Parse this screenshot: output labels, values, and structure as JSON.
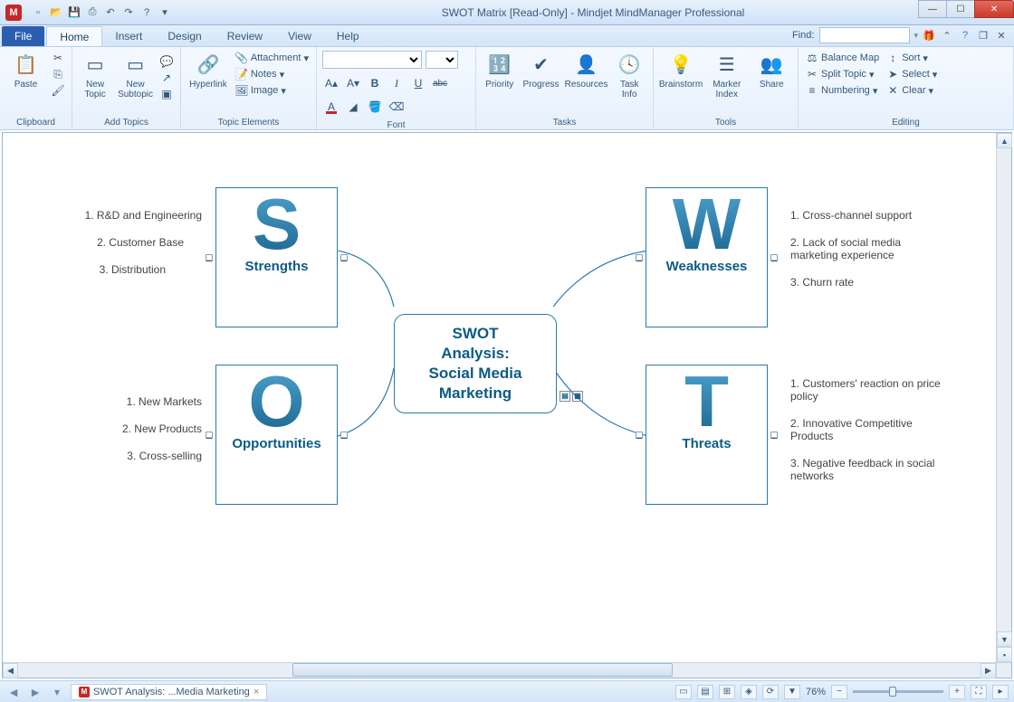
{
  "window": {
    "title": "SWOT Matrix [Read-Only] - Mindjet MindManager Professional",
    "appIconLetter": "M"
  },
  "tabs": {
    "file": "File",
    "home": "Home",
    "insert": "Insert",
    "design": "Design",
    "review": "Review",
    "view": "View",
    "help": "Help"
  },
  "find": {
    "label": "Find:",
    "value": ""
  },
  "ribbon": {
    "clipboard": {
      "paste": "Paste",
      "group": "Clipboard"
    },
    "addTopics": {
      "newTopic": "New\nTopic",
      "newSubtopic": "New\nSubtopic",
      "group": "Add Topics"
    },
    "topicElements": {
      "hyperlink": "Hyperlink",
      "attachment": "Attachment",
      "notes": "Notes",
      "image": "Image",
      "group": "Topic Elements"
    },
    "font": {
      "group": "Font",
      "increase": "A▴",
      "decrease": "A▾",
      "bold": "B",
      "italic": "I",
      "underline": "U",
      "strike": "abc"
    },
    "tasks": {
      "priority": "Priority",
      "progress": "Progress",
      "resources": "Resources",
      "taskInfo": "Task\nInfo",
      "group": "Tasks"
    },
    "tools": {
      "brainstorm": "Brainstorm",
      "markerIndex": "Marker\nIndex",
      "share": "Share",
      "group": "Tools"
    },
    "editing": {
      "balanceMap": "Balance Map",
      "splitTopic": "Split Topic",
      "numbering": "Numbering",
      "sort": "Sort",
      "select": "Select",
      "clear": "Clear",
      "group": "Editing"
    }
  },
  "mindmap": {
    "central": {
      "line1": "SWOT",
      "line2": "Analysis:",
      "line3": "Social Media",
      "line4": "Marketing"
    },
    "boxes": {
      "s": {
        "letter": "S",
        "label": "Strengths"
      },
      "w": {
        "letter": "W",
        "label": "Weaknesses"
      },
      "o": {
        "letter": "O",
        "label": "Opportunities"
      },
      "t": {
        "letter": "T",
        "label": "Threats"
      }
    },
    "items": {
      "s": [
        "1. R&D and Engineering",
        "2. Customer Base",
        "3. Distribution"
      ],
      "w": [
        "1. Cross-channel support",
        "2. Lack of social media marketing experience",
        "3. Churn rate"
      ],
      "o": [
        "1. New Markets",
        "2. New Products",
        "3. Cross-selling"
      ],
      "t": [
        "1. Customers' reaction on price policy",
        "2. Innovative Competitive Products",
        "3. Negative feedback in social networks"
      ]
    }
  },
  "statusbar": {
    "docTab": "SWOT Analysis: ...Media Marketing",
    "zoom": "76%"
  }
}
